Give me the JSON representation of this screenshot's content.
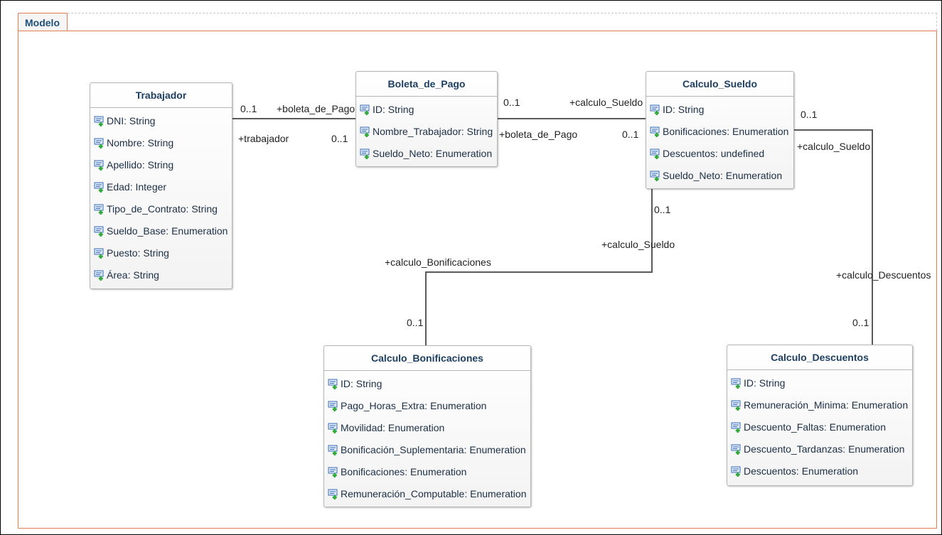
{
  "package": {
    "name": "Modelo"
  },
  "classes": {
    "trabajador": {
      "name": "Trabajador",
      "attributes": [
        "DNI: String",
        "Nombre: String",
        "Apellido: String",
        "Edad: Integer",
        "Tipo_de_Contrato: String",
        "Sueldo_Base: Enumeration",
        "Puesto: String",
        "Área: String"
      ]
    },
    "boleta": {
      "name": "Boleta_de_Pago",
      "attributes": [
        "ID: String",
        "Nombre_Trabajador: String",
        "Sueldo_Neto: Enumeration"
      ]
    },
    "calculo_sueldo": {
      "name": "Calculo_Sueldo",
      "attributes": [
        "ID: String",
        "Bonificaciones: Enumeration",
        "Descuentos: undefined",
        "Sueldo_Neto: Enumeration"
      ]
    },
    "calculo_bonificaciones": {
      "name": "Calculo_Bonificaciones",
      "attributes": [
        "ID: String",
        "Pago_Horas_Extra: Enumeration",
        "Movilidad: Enumeration",
        "Bonificación_Suplementaria: Enumeration",
        "Bonificaciones: Enumeration",
        "Remuneración_Computable: Enumeration"
      ]
    },
    "calculo_descuentos": {
      "name": "Calculo_Descuentos",
      "attributes": [
        "ID: String",
        "Remuneración_Minima: Enumeration",
        "Descuento_Faltas: Enumeration",
        "Descuento_Tardanzas: Enumeration",
        "Descuentos: Enumeration"
      ]
    }
  },
  "associations": {
    "trabajador_boleta": {
      "mult_a": "0..1",
      "role_a": "+boleta_de_Pago",
      "role_b": "+trabajador",
      "mult_b": "0..1"
    },
    "boleta_sueldo": {
      "mult_a": "0..1",
      "role_a": "+calculo_Sueldo",
      "role_b": "+boleta_de_Pago",
      "mult_b": "0..1"
    },
    "sueldo_bonificaciones": {
      "mult_a": "0..1",
      "role_a": "+calculo_Sueldo",
      "role_b": "+calculo_Bonificaciones",
      "mult_b": "0..1"
    },
    "sueldo_descuentos": {
      "mult_a": "0..1",
      "role_a": "+calculo_Sueldo",
      "role_b": "+calculo_Descuentos",
      "mult_b": "0..1"
    }
  },
  "icons": {
    "attribute": "attribute-icon"
  },
  "colors": {
    "package_border": "#e07d52",
    "class_title": "#1c3f63",
    "icon_blue": "#3a6fb7",
    "icon_green": "#2faa3a"
  }
}
